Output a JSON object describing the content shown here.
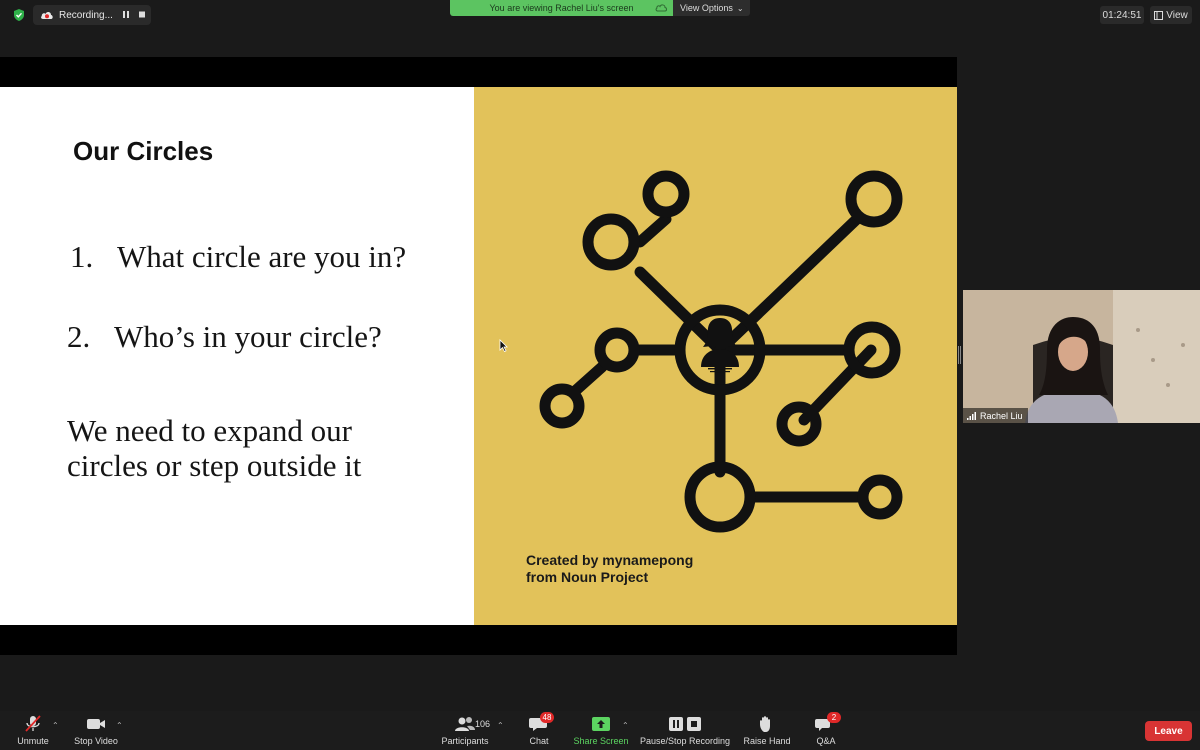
{
  "top_bar": {
    "recording_label": "Recording...",
    "viewing_banner": "You are viewing Rachel Liu's screen",
    "view_options_label": "View Options",
    "timer": "01:24:51",
    "view_label": "View"
  },
  "slide": {
    "title": "Our Circles",
    "questions": [
      {
        "num": "1.",
        "text": "What circle are you in?"
      },
      {
        "num": "2.",
        "text": "Who’s in your circle?"
      }
    ],
    "statement": "We need to expand our circles or step outside it",
    "credit_line1": "Created by mynamepong",
    "credit_line2": "from Noun Project",
    "panel_color": "#e2c25a"
  },
  "video_tile": {
    "participant_name": "Rachel Liu"
  },
  "toolbar": {
    "unmute_label": "Unmute",
    "stop_video_label": "Stop Video",
    "participants_label": "Participants",
    "participants_count": "106",
    "chat_label": "Chat",
    "chat_badge": "48",
    "share_screen_label": "Share Screen",
    "pause_recording_label": "Pause/Stop Recording",
    "raise_hand_label": "Raise Hand",
    "qa_label": "Q&A",
    "qa_badge": "2",
    "leave_label": "Leave"
  },
  "colors": {
    "accent_green": "#5cc461",
    "leave_red": "#d83434",
    "badge_red": "#e02828"
  }
}
